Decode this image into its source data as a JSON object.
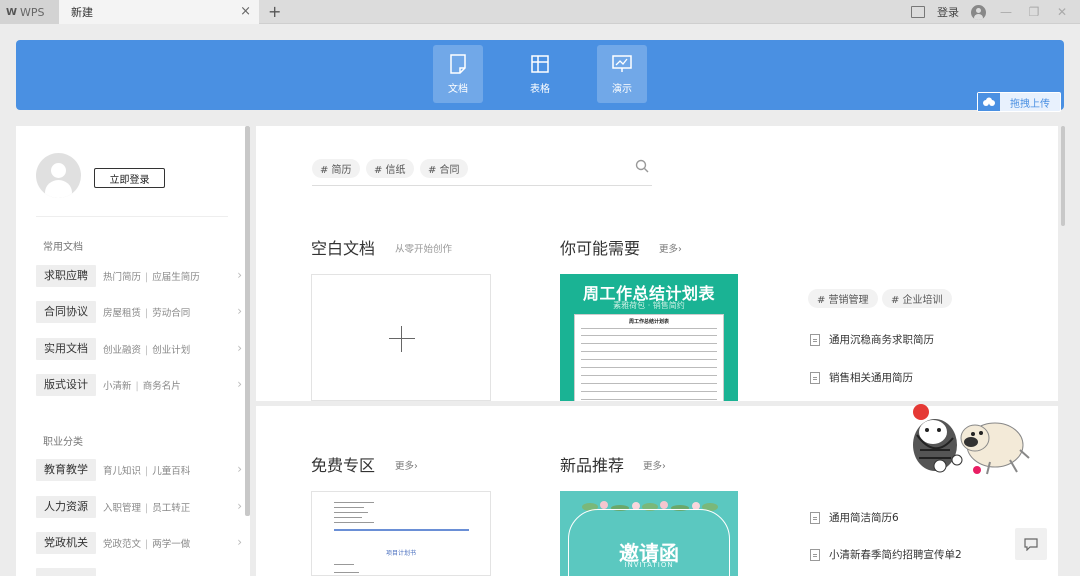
{
  "titlebar": {
    "app_tab": "WPS",
    "app_logo": "W",
    "doc_tab": "新建",
    "close_icon": "×",
    "add_icon": "+",
    "login": "登录"
  },
  "banner": {
    "nav": [
      {
        "label": "文档",
        "icon": "document-icon",
        "active": true
      },
      {
        "label": "表格",
        "icon": "table-icon",
        "active": false
      },
      {
        "label": "演示",
        "icon": "presentation-icon",
        "active": true
      }
    ],
    "upload_label": "拖拽上传",
    "color": "#4a90e2"
  },
  "sidebar": {
    "login_button": "立即登录",
    "section1": "常用文档",
    "rows1": [
      {
        "cat": "求职应聘",
        "l1": "热门简历",
        "l2": "应届生简历"
      },
      {
        "cat": "合同协议",
        "l1": "房屋租赁",
        "l2": "劳动合同"
      },
      {
        "cat": "实用文档",
        "l1": "创业融资",
        "l2": "创业计划"
      },
      {
        "cat": "版式设计",
        "l1": "小清新",
        "l2": "商务名片"
      }
    ],
    "section2": "职业分类",
    "rows2": [
      {
        "cat": "教育教学",
        "l1": "育儿知识",
        "l2": "儿童百科"
      },
      {
        "cat": "人力资源",
        "l1": "入职管理",
        "l2": "员工转正"
      },
      {
        "cat": "党政机关",
        "l1": "党政范文",
        "l2": "两学一做"
      }
    ],
    "sep": "|",
    "arrow": "›"
  },
  "search": {
    "tags": [
      "# 简历",
      "# 信纸",
      "# 合同"
    ]
  },
  "blank": {
    "title": "空白文档",
    "subtitle": "从零开始创作"
  },
  "suggest": {
    "title": "你可能需要",
    "more": "更多›",
    "thumb_title": "周工作总结计划表",
    "thumb_sub": "素雅荷包 · 销售简约",
    "sheet_title": "周工作总结计划表",
    "tags": [
      "# 营销管理",
      "# 企业培训"
    ],
    "links": [
      "通用沉稳商务求职简历",
      "销售相关通用简历"
    ]
  },
  "free": {
    "title": "免费专区",
    "more": "更多›",
    "thumb_text": "项目计划书"
  },
  "newitems": {
    "title": "新品推荐",
    "more": "更多›",
    "inv_title": "邀请函",
    "inv_en": "INVITATION",
    "links": [
      "通用简洁简历6",
      "小清新春季简约招聘宣传单2"
    ]
  }
}
